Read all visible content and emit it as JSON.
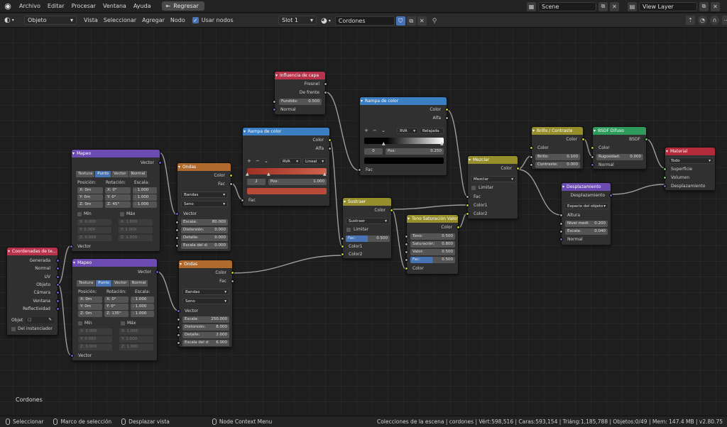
{
  "topbar": {
    "menu": [
      "Archivo",
      "Editar",
      "Procesar",
      "Ventana",
      "Ayuda"
    ],
    "back_label": "Regresar",
    "scene": "Scene",
    "view_layer": "View Layer"
  },
  "header": {
    "object_mode": "Objeto",
    "menu": [
      "Vista",
      "Seleccionar",
      "Agregar",
      "Nodo"
    ],
    "use_nodes_label": "Usar nodos",
    "slot": "Slot 1",
    "material_name": "Cordones"
  },
  "nodes": {
    "coord": {
      "title": "Coordenadas de te...",
      "outputs": [
        "Generada",
        "Normal",
        "UV",
        "Objeto",
        "Cámara",
        "Ventana",
        "Reflectividad"
      ],
      "object_label": "Objet",
      "instancer_label": "Del instanciador"
    },
    "mapping1": {
      "title": "Mapeo",
      "out": "Vector",
      "tabs": [
        "Textura",
        "Punto",
        "Vector",
        "Normal"
      ],
      "pos_label": "Posición:",
      "rot_label": "Rotación:",
      "scale_label": "Escala:",
      "pos": [
        "X: 0m",
        "Y: 0m",
        "Z: 0m"
      ],
      "rot": [
        "X: 0°",
        "Y: 0°",
        "Z: 45°"
      ],
      "scale": [
        ": 1.000",
        ": 1.000",
        ": 1.000"
      ],
      "min_label": "Mín",
      "max_label": "Máx",
      "min": [
        "X: 0.000",
        "Y: 0.000",
        "Z: 0.000"
      ],
      "max": [
        "X: 1.000",
        "Y: 1.000",
        "Z: 1.000"
      ],
      "in": "Vector"
    },
    "mapping2": {
      "title": "Mapeo",
      "out": "Vector",
      "tabs": [
        "Textura",
        "Punto",
        "Vector",
        "Normal"
      ],
      "pos_label": "Posición:",
      "rot_label": "Rotación:",
      "scale_label": "Escala:",
      "pos": [
        "X: 0m",
        "Y: 0m",
        "Z: 0m"
      ],
      "rot": [
        "X: 0°",
        "Y: 0°",
        "Z: 135°"
      ],
      "scale": [
        ": 1.000",
        ": 1.000",
        ": 1.000"
      ],
      "min_label": "Mín",
      "max_label": "Máx",
      "min": [
        "X: 0.000",
        "Y: 0.000",
        "Z: 0.000"
      ],
      "max": [
        "X: 1.000",
        "Y: 1.000",
        "Z: 1.000"
      ],
      "in": "Vector"
    },
    "waves1": {
      "title": "Ondas",
      "outputs": [
        "Color",
        "Fac"
      ],
      "type": "Bandas",
      "profile": "Seno",
      "in": "Vector",
      "fields": [
        [
          "Escala:",
          "80.000"
        ],
        [
          "Distorsión:",
          "0.000"
        ],
        [
          "Detalle:",
          "0.000"
        ],
        [
          "Escala del d:",
          "0.000"
        ]
      ]
    },
    "waves2": {
      "title": "Ondas",
      "outputs": [
        "Color",
        "Fac"
      ],
      "type": "Bandas",
      "profile": "Seno",
      "in": "Vector",
      "fields": [
        [
          "Escala:",
          "250.000"
        ],
        [
          "Distorsión:",
          "8.000"
        ],
        [
          "Detalle:",
          "2.000"
        ],
        [
          "Escala del d:",
          "6.000"
        ]
      ]
    },
    "ramp1": {
      "title": "Rampa de color",
      "outputs": [
        "Color",
        "Alfa"
      ],
      "mode": "RVA",
      "interp": "Lineal",
      "index": "2",
      "pos_label": "Pos:",
      "pos": "1.000",
      "in": "Fac",
      "color": "#b84a3a"
    },
    "layer_weight": {
      "title": "Influencia de capa",
      "outputs": [
        "Fresnel",
        "De frente"
      ],
      "blend_label": "Fundido:",
      "blend": "0.500",
      "in": "Normal"
    },
    "ramp2": {
      "title": "Rampa de color",
      "outputs": [
        "Color",
        "Alfa"
      ],
      "mode": "RVA",
      "interp": "Relajada",
      "index": "0",
      "pos_label": "Pos:",
      "pos": "0.250",
      "in": "Fac"
    },
    "subtract": {
      "title": "Sustraer",
      "out": "Color",
      "op": "Sustraer",
      "clamp": "Limitar",
      "fac_label": "Fac:",
      "fac": "0.500",
      "inputs": [
        "Color1",
        "Color2"
      ]
    },
    "hsv": {
      "title": "Tono Saturación Valor",
      "out": "Color",
      "fields": [
        [
          "Tono:",
          "0.500"
        ],
        [
          "Saturación:",
          "0.800"
        ],
        [
          "Valor:",
          "0.500"
        ],
        [
          "Fac:",
          "0.500"
        ]
      ],
      "in": "Color"
    },
    "mix": {
      "title": "Mezclar",
      "out": "Color",
      "op": "Mezclar",
      "clamp": "Limitar",
      "inputs": [
        "Fac",
        "Color1",
        "Color2"
      ]
    },
    "bright": {
      "title": "Brillo / Contraste",
      "out": "Color",
      "in": "Color",
      "fields": [
        [
          "Brillo:",
          "0.100"
        ],
        [
          "Contraste:",
          "0.000"
        ]
      ]
    },
    "diffuse": {
      "title": "BSDF Difuso",
      "out": "BSDF",
      "in": "Color",
      "rough_label": "Rugosidad:",
      "rough": "0.000",
      "normal": "Normal"
    },
    "displace": {
      "title": "Desplazamiento",
      "out": "Desplazamiento",
      "space": "Espacio del objeto",
      "inputs": [
        "Altura",
        "Normal"
      ],
      "fields": [
        [
          "Nivel medi:",
          "0.200"
        ],
        [
          "Escala:",
          "0.040"
        ]
      ]
    },
    "output": {
      "title": "Material",
      "target": "Todo",
      "inputs": [
        "Superficie",
        "Volumen",
        "Desplazamiento"
      ]
    }
  },
  "canvas_label": "Cordones",
  "status": {
    "items": [
      "Seleccionar",
      "Marco de selección",
      "Desplazar vista",
      "Node Context Menu"
    ],
    "info": "Colecciones de la escena | cordones | Vért:598,516 | Caras:593,154 | Triáng:1,185,788 | Objetos:0/49 | Mem: 147.4 MB | v2.80.75"
  }
}
